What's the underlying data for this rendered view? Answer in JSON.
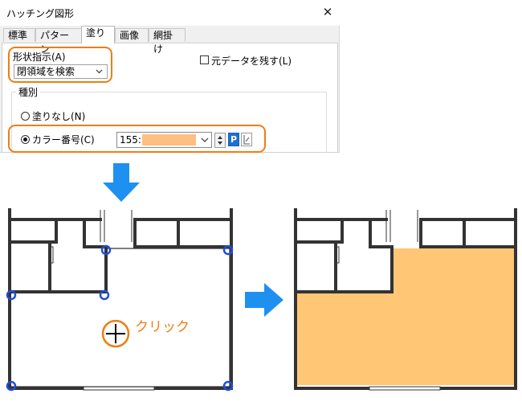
{
  "dialog": {
    "title": "ハッチング図形",
    "close_glyph": "✕",
    "tabs": [
      "標準",
      "パターン",
      "塗り",
      "画像",
      "網掛け"
    ],
    "active_tab": "塗り",
    "shape_label": "形状指示(A)",
    "shape_value": "閉領域を検索",
    "keep_original_label": "元データを残す(L)",
    "keep_original_checked": false,
    "type_group_label": "種別",
    "radio_none_label": "塗りなし(N)",
    "radio_color_label": "カラー番号(C)",
    "selected_radio": "color",
    "color_number": "155:",
    "color_swatch": "#ffbe82",
    "p_button_label": "P"
  },
  "annotation": {
    "click_label": "クリック"
  },
  "colors": {
    "accent_orange": "#f07d14",
    "arrow_blue": "#1e90f0",
    "fill_orange": "#ffc675",
    "vertex_blue": "#1f4fd8",
    "wall": "#333333"
  },
  "icons": {
    "down_arrow": "down-arrow-icon",
    "right_arrow": "right-arrow-icon",
    "crosshair": "crosshair-icon",
    "eyedropper": "eyedropper-icon",
    "spin": "spin-arrows-icon",
    "chevron": "chevron-down-icon"
  }
}
